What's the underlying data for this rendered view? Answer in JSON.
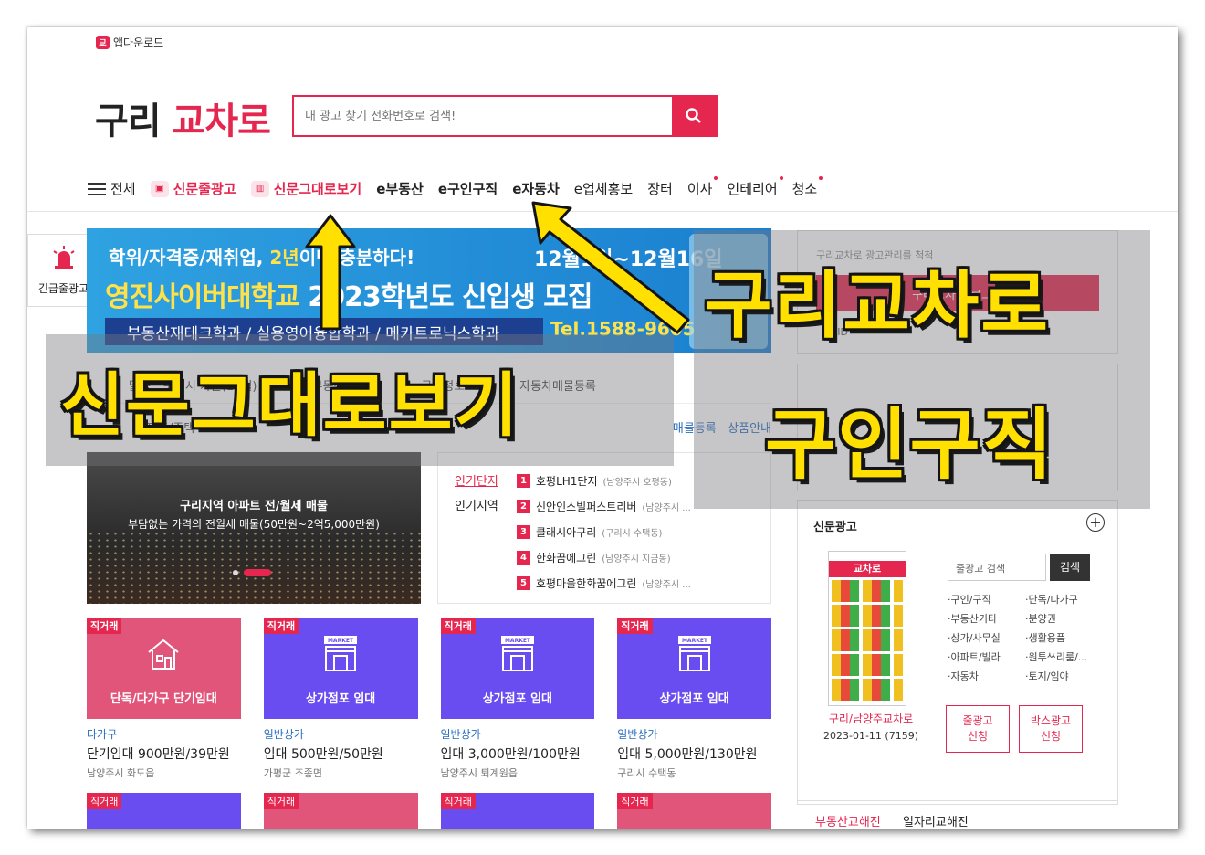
{
  "topbar": {
    "app_download": "앱다운로드"
  },
  "logo": {
    "part1": "구리",
    "part2": "교차로"
  },
  "search": {
    "placeholder": "내 광고 찾기 전화번호로 검색!"
  },
  "nav": {
    "all": "전체",
    "items": [
      "신문줄광고",
      "신문그대로보기",
      "e부동산",
      "e구인구직",
      "e자동차",
      "e업체홍보",
      "장터",
      "이사",
      "인테리어",
      "청소"
    ]
  },
  "urgent": {
    "label": "긴급줄광고"
  },
  "banner": {
    "line1a": "학위/자격증/재취업, ",
    "line1b": "2년",
    "line1c": "이면 충분하다!",
    "line2a": "영진사이버대학교",
    "line2b": " 2023학년도 신입생 모집",
    "line3": "부동산재테크학과 / 실용영어융합학과 / 메카트로닉스학과",
    "date": "12월1일~12월16일",
    "tel": "Tel.1588-9605"
  },
  "subnav": {
    "items": [
      "맑음",
      "구리시 가을(11월)",
      "부동산매물",
      "구인정보",
      "자동차매물등록"
    ]
  },
  "subnav2": {
    "left": "아파트/주택",
    "link1": "매물등록",
    "link2": "상품안내"
  },
  "photo": {
    "title": "구리지역 아파트 전/월세 매물",
    "subtitle": "부담없는 가격의 전월세 매물(50만원~2억5,000만원)"
  },
  "popular": {
    "tab_on": "인기단지",
    "tab_off": "인기지역",
    "items": [
      {
        "rank": "1",
        "name": "호평LH1단지",
        "loc": "(남양주시 호평동)"
      },
      {
        "rank": "2",
        "name": "신안인스빌퍼스트리버",
        "loc": "(남양주시 ..."
      },
      {
        "rank": "3",
        "name": "클래시아구리",
        "loc": "(구리시 수택동)"
      },
      {
        "rank": "4",
        "name": "한화꿈에그린",
        "loc": "(남양주시 지금동)"
      },
      {
        "rank": "5",
        "name": "호평마을한화꿈에그린",
        "loc": "(남양주시 ..."
      }
    ]
  },
  "cards": [
    {
      "tag": "직거래",
      "title": "단독/다가구 단기임대",
      "category": "다가구",
      "price": "단기임대 900만원/39만원",
      "location": "남양주시 화도읍",
      "color": "#e2557a",
      "icon": "house-icon"
    },
    {
      "tag": "직거래",
      "title": "상가점포 임대",
      "category": "일반상가",
      "price": "임대 500만원/50만원",
      "location": "가평군 조종면",
      "color": "#6a4df0",
      "icon": "market-icon"
    },
    {
      "tag": "직거래",
      "title": "상가점포 임대",
      "category": "일반상가",
      "price": "임대 3,000만원/100만원",
      "location": "남양주시 퇴계원읍",
      "color": "#6a4df0",
      "icon": "market-icon"
    },
    {
      "tag": "직거래",
      "title": "상가점포 임대",
      "category": "일반상가",
      "price": "임대 5,000만원/130만원",
      "location": "구리시 수택동",
      "color": "#6a4df0",
      "icon": "market-icon"
    }
  ],
  "cards_row2": [
    {
      "tag": "직거래"
    },
    {
      "tag": "직거래"
    },
    {
      "tag": "직거래"
    },
    {
      "tag": "직거래"
    }
  ],
  "right": {
    "login_notice": "구리교차로 광고관리를 척척",
    "login_button": "구리교차로 로그인",
    "id_label": "ID"
  },
  "news": {
    "header": "신문광고",
    "masthead": "교차로",
    "search_placeholder": "줄광고 검색",
    "search_button": "검색",
    "categories": [
      "·구인/구직",
      "·단독/다가구",
      "·부동산기타",
      "·분양권",
      "·상가/사무실",
      "·생활용품",
      "·아파트/빌라",
      "·원투쓰리룸/...",
      "·자동차",
      "·토지/임야"
    ],
    "caption": "구리/남양주교차로",
    "date": "2023-01-11 (7159)",
    "btn1a": "줄광고",
    "btn1b": "신청",
    "btn2a": "박스광고",
    "btn2b": "신청"
  },
  "bottom_tabs": {
    "tab1": "부동산교해진",
    "tab2": "일자리교해진"
  },
  "overlay": {
    "left_text": "신문그대로보기",
    "right_line1": "구리교차로",
    "right_line2": "구인구직"
  },
  "colors": {
    "accent": "#e5264f",
    "highlight": "#ffe000",
    "card_purple": "#6a4df0",
    "card_pink": "#e2557a"
  }
}
